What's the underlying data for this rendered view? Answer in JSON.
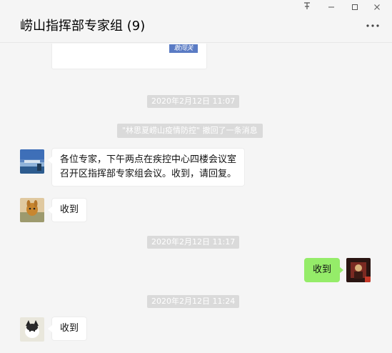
{
  "window": {
    "title": "崂山指挥部专家组 (9)",
    "pin_icon": "pin-icon",
    "minimize_icon": "minimize-icon",
    "maximize_icon": "maximize-icon",
    "close_icon": "close-icon",
    "more_icon": "more-dots-icon"
  },
  "chat": {
    "card": {
      "thumb_text": "敢闯关"
    },
    "timestamps": [
      "2020年2月12日 11:07",
      "2020年2月12日 11:17",
      "2020年2月12日 11:24"
    ],
    "recall_notice": "\"林思夏崂山疫情防控\" 撤回了一条消息",
    "messages": [
      {
        "side": "left",
        "line1": "各位专家，下午两点在疾控中心四楼会议室",
        "line2": "召开区指挥部专家组会议。收到，请回复。"
      },
      {
        "side": "left",
        "text": "收到"
      },
      {
        "side": "right",
        "text": "收到"
      },
      {
        "side": "left",
        "text": "收到"
      }
    ]
  },
  "colors": {
    "background": "#f5f5f5",
    "bubble_mine": "#95ec69",
    "bubble_other": "#ffffff",
    "timestamp_bg": "#dadada"
  }
}
